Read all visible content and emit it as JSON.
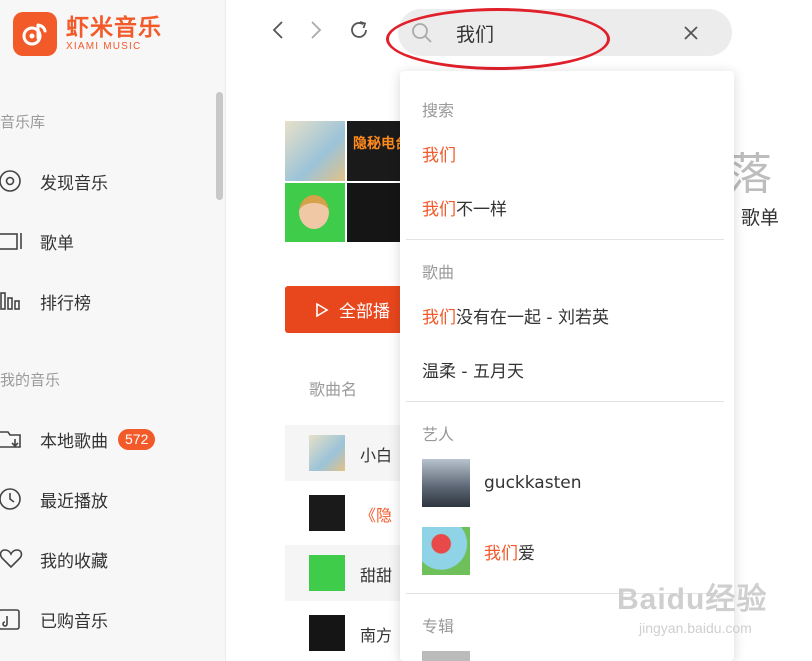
{
  "app": {
    "name_cn": "虾米音乐",
    "name_en": "XIAMI MUSIC",
    "brand_color": "#f35a2a"
  },
  "sidebar": {
    "section_library": "音乐库",
    "library_items": [
      {
        "label": "发现音乐",
        "icon": "disc-icon"
      },
      {
        "label": "歌单",
        "icon": "playlist-icon"
      },
      {
        "label": "排行榜",
        "icon": "chart-bars-icon"
      }
    ],
    "section_mine": "我的音乐",
    "mine_items": [
      {
        "label": "本地歌曲",
        "icon": "local-folder-icon",
        "badge": "572"
      },
      {
        "label": "最近播放",
        "icon": "clock-icon"
      },
      {
        "label": "我的收藏",
        "icon": "heart-icon"
      },
      {
        "label": "已购音乐",
        "icon": "purchased-icon"
      }
    ]
  },
  "toolbar": {
    "back_icon": "chevron-left-icon",
    "forward_icon": "chevron-right-icon",
    "refresh_icon": "refresh-icon"
  },
  "search": {
    "value": "我们",
    "clear_icon": "close-icon"
  },
  "main": {
    "big_char": "落",
    "tab_label": "歌单",
    "play_all_label": "全部播",
    "column_song": "歌曲名",
    "cover_text": "隐秘电台",
    "songs": [
      {
        "title": "小白"
      },
      {
        "title": "《隐",
        "highlight": true
      },
      {
        "title": "甜甜"
      },
      {
        "title": "南方"
      }
    ]
  },
  "dropdown": {
    "section_search": "搜索",
    "search_items": [
      {
        "hl": "我们",
        "rest": ""
      },
      {
        "hl": "我们",
        "rest": "不一样"
      }
    ],
    "section_songs": "歌曲",
    "song_items": [
      {
        "hl": "我们",
        "rest": "没有在一起 - 刘若英"
      },
      {
        "hl": "",
        "rest": "温柔 - 五月天"
      }
    ],
    "section_artists": "艺人",
    "artist_items": [
      {
        "hl": "",
        "rest": "guckkasten"
      },
      {
        "hl": "我们",
        "rest": "爱"
      }
    ],
    "section_albums": "专辑"
  },
  "watermark": {
    "main": "Baidu经验",
    "sub": "jingyan.baidu.com"
  }
}
